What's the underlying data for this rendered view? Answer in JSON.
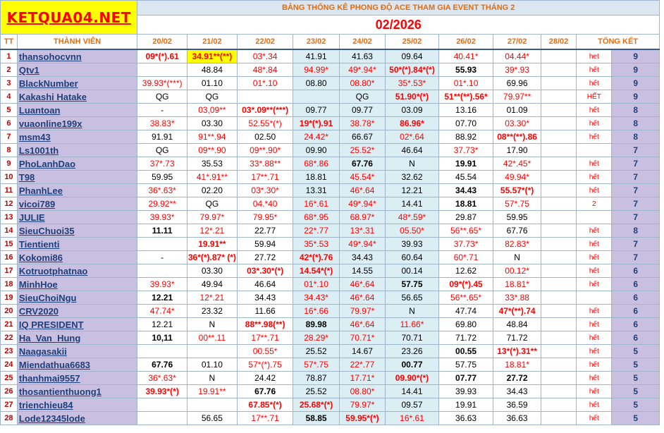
{
  "header": {
    "logo": "KETQUA04.NET",
    "title": "BẢNG THỐNG KÊ PHONG ĐỘ ACE THAM GIA EVENT THÁNG 2",
    "month": "02/2026",
    "col_tt": "TT",
    "col_member": "THÀNH VIÊN",
    "col_total": "TỔNG KẾT",
    "dates": [
      "20/02",
      "21/02",
      "22/02",
      "23/02",
      "24/02",
      "25/02",
      "26/02",
      "27/02",
      "28/02"
    ]
  },
  "rows": [
    {
      "tt": "1",
      "name": "thansohocvnn",
      "cells": [
        {
          "v": "09*(*).61",
          "s": "rb"
        },
        {
          "v": "34.91**(**)",
          "s": "rby"
        },
        {
          "v": "03*.34",
          "s": "r"
        },
        {
          "v": "41.91",
          "s": ""
        },
        {
          "v": "41.63",
          "s": ""
        },
        {
          "v": "09.64",
          "s": ""
        },
        {
          "v": "40.41*",
          "s": "r"
        },
        {
          "v": "04.44*",
          "s": "r"
        },
        {
          "v": "",
          "s": ""
        }
      ],
      "note": "het",
      "total": "9"
    },
    {
      "tt": "2",
      "name": "Qtv1",
      "cells": [
        {
          "v": "",
          "s": ""
        },
        {
          "v": "48.84",
          "s": ""
        },
        {
          "v": "48*.84",
          "s": "r"
        },
        {
          "v": "94.99*",
          "s": "r"
        },
        {
          "v": "49*.94*",
          "s": "r"
        },
        {
          "v": "50*(*).84*(*)",
          "s": "rb"
        },
        {
          "v": "55.93",
          "s": "b"
        },
        {
          "v": "39*.93",
          "s": "r"
        },
        {
          "v": "",
          "s": ""
        }
      ],
      "note": "hết",
      "total": "9"
    },
    {
      "tt": "3",
      "name": "BlackNumber",
      "cells": [
        {
          "v": "39.93*(***)",
          "s": "r"
        },
        {
          "v": "01.10",
          "s": ""
        },
        {
          "v": "01*.10",
          "s": "r"
        },
        {
          "v": "08.80",
          "s": ""
        },
        {
          "v": "08.80*",
          "s": "r"
        },
        {
          "v": "35*.53*",
          "s": "r"
        },
        {
          "v": "01*.10",
          "s": "r"
        },
        {
          "v": "69.96",
          "s": ""
        },
        {
          "v": "",
          "s": ""
        }
      ],
      "note": "hết",
      "total": "9"
    },
    {
      "tt": "4",
      "name": "Kakashi Hatake",
      "cells": [
        {
          "v": "QG",
          "s": ""
        },
        {
          "v": "QG",
          "s": ""
        },
        {
          "v": "",
          "s": ""
        },
        {
          "v": "",
          "s": ""
        },
        {
          "v": "QG",
          "s": ""
        },
        {
          "v": "51.90*(*)",
          "s": "rb"
        },
        {
          "v": "51**(**).56*",
          "s": "rb"
        },
        {
          "v": "79.97**",
          "s": "r"
        },
        {
          "v": "",
          "s": ""
        }
      ],
      "note": "HẾT",
      "total": "9"
    },
    {
      "tt": "5",
      "name": "Luantoan",
      "cells": [
        {
          "v": "-",
          "s": ""
        },
        {
          "v": "03,09**",
          "s": "r"
        },
        {
          "v": "03*.09**(***)",
          "s": "rb"
        },
        {
          "v": "09.77",
          "s": ""
        },
        {
          "v": "09.77",
          "s": ""
        },
        {
          "v": "03.09",
          "s": ""
        },
        {
          "v": "13.16",
          "s": ""
        },
        {
          "v": "01.09",
          "s": ""
        },
        {
          "v": "",
          "s": ""
        }
      ],
      "note": "hết",
      "total": "8"
    },
    {
      "tt": "6",
      "name": "vuaonline199x",
      "cells": [
        {
          "v": "38.83*",
          "s": "r"
        },
        {
          "v": "03.30",
          "s": ""
        },
        {
          "v": "52.55*(*)",
          "s": "r"
        },
        {
          "v": "19*(*).91",
          "s": "rb"
        },
        {
          "v": "38.78*",
          "s": "r"
        },
        {
          "v": "86.96*",
          "s": "rb"
        },
        {
          "v": "07.70",
          "s": ""
        },
        {
          "v": "03.30*",
          "s": "r"
        },
        {
          "v": "",
          "s": ""
        }
      ],
      "note": "hết",
      "total": "8"
    },
    {
      "tt": "7",
      "name": "msm43",
      "cells": [
        {
          "v": "91.91",
          "s": ""
        },
        {
          "v": "91**.94",
          "s": "r"
        },
        {
          "v": "02.50",
          "s": ""
        },
        {
          "v": "24.42*",
          "s": "r"
        },
        {
          "v": "66.67",
          "s": ""
        },
        {
          "v": "02*.64",
          "s": "r"
        },
        {
          "v": "88.92",
          "s": ""
        },
        {
          "v": "08**(**).86",
          "s": "rb"
        },
        {
          "v": "",
          "s": ""
        }
      ],
      "note": "hết",
      "total": "8"
    },
    {
      "tt": "8",
      "name": "Ls1001th",
      "cells": [
        {
          "v": "QG",
          "s": ""
        },
        {
          "v": "09**.90",
          "s": "r"
        },
        {
          "v": "09**.90*",
          "s": "r"
        },
        {
          "v": "09.90",
          "s": ""
        },
        {
          "v": "25.52*",
          "s": "r"
        },
        {
          "v": "46.64",
          "s": ""
        },
        {
          "v": "37.73*",
          "s": "r"
        },
        {
          "v": "17.90",
          "s": ""
        },
        {
          "v": "",
          "s": ""
        }
      ],
      "note": "",
      "total": "7"
    },
    {
      "tt": "9",
      "name": "PhoLanhDao",
      "cells": [
        {
          "v": "37*.73",
          "s": "r"
        },
        {
          "v": "35.53",
          "s": ""
        },
        {
          "v": "33*.88**",
          "s": "r"
        },
        {
          "v": "68*.86",
          "s": "r"
        },
        {
          "v": "67.76",
          "s": "b"
        },
        {
          "v": "N",
          "s": ""
        },
        {
          "v": "19.91",
          "s": "b"
        },
        {
          "v": "42*.45*",
          "s": "r"
        },
        {
          "v": "",
          "s": ""
        }
      ],
      "note": "hết",
      "total": "7"
    },
    {
      "tt": "10",
      "name": "T98",
      "cells": [
        {
          "v": "59.95",
          "s": ""
        },
        {
          "v": "41*.91**",
          "s": "r"
        },
        {
          "v": "17**.71",
          "s": "r"
        },
        {
          "v": "18.81",
          "s": ""
        },
        {
          "v": "45.54*",
          "s": "r"
        },
        {
          "v": "32.62",
          "s": ""
        },
        {
          "v": "45.54",
          "s": ""
        },
        {
          "v": "49.94*",
          "s": "r"
        },
        {
          "v": "",
          "s": ""
        }
      ],
      "note": "hết",
      "total": "7"
    },
    {
      "tt": "11",
      "name": "PhanhLee",
      "cells": [
        {
          "v": "36*.63*",
          "s": "r"
        },
        {
          "v": "02.20",
          "s": ""
        },
        {
          "v": "03*.30*",
          "s": "r"
        },
        {
          "v": "13.31",
          "s": ""
        },
        {
          "v": "46*.64",
          "s": "r"
        },
        {
          "v": "12.21",
          "s": ""
        },
        {
          "v": "34.43",
          "s": "b"
        },
        {
          "v": "55.57*(*)",
          "s": "rb"
        },
        {
          "v": "",
          "s": ""
        }
      ],
      "note": "hết",
      "total": "7"
    },
    {
      "tt": "12",
      "name": "vicoi789",
      "cells": [
        {
          "v": "29.92**",
          "s": "r"
        },
        {
          "v": "QG",
          "s": ""
        },
        {
          "v": "04.*40",
          "s": "r"
        },
        {
          "v": "16*.61",
          "s": "r"
        },
        {
          "v": "49*.94*",
          "s": "r"
        },
        {
          "v": "14.41",
          "s": ""
        },
        {
          "v": "18.81",
          "s": "b"
        },
        {
          "v": "57*.75",
          "s": "r"
        },
        {
          "v": "",
          "s": ""
        }
      ],
      "note": "2",
      "total": "7"
    },
    {
      "tt": "13",
      "name": "JULIE",
      "cells": [
        {
          "v": "39.93*",
          "s": "r"
        },
        {
          "v": "79.97*",
          "s": "r"
        },
        {
          "v": "79.95*",
          "s": "r"
        },
        {
          "v": "68*.95",
          "s": "r"
        },
        {
          "v": "68.97*",
          "s": "r"
        },
        {
          "v": "48*.59*",
          "s": "r"
        },
        {
          "v": "29.87",
          "s": ""
        },
        {
          "v": "59.95",
          "s": ""
        },
        {
          "v": "",
          "s": ""
        }
      ],
      "note": "",
      "total": "7"
    },
    {
      "tt": "14",
      "name": "SieuChuoi35",
      "cells": [
        {
          "v": "11.11",
          "s": "b"
        },
        {
          "v": "12*.21",
          "s": "r"
        },
        {
          "v": "22.77",
          "s": ""
        },
        {
          "v": "22*.77",
          "s": "r"
        },
        {
          "v": "13*.31",
          "s": "r"
        },
        {
          "v": "05.50*",
          "s": "r"
        },
        {
          "v": "56**.65*",
          "s": "r"
        },
        {
          "v": "67.76",
          "s": ""
        },
        {
          "v": "",
          "s": ""
        }
      ],
      "note": "hết",
      "total": "8"
    },
    {
      "tt": "15",
      "name": "Tientienti",
      "cells": [
        {
          "v": "",
          "s": ""
        },
        {
          "v": "19.91**",
          "s": "rb"
        },
        {
          "v": "59.94",
          "s": ""
        },
        {
          "v": "35*.53",
          "s": "r"
        },
        {
          "v": "49*.94*",
          "s": "r"
        },
        {
          "v": "39.93",
          "s": ""
        },
        {
          "v": "37.73*",
          "s": "r"
        },
        {
          "v": "82.83*",
          "s": "r"
        },
        {
          "v": "",
          "s": ""
        }
      ],
      "note": "hết",
      "total": "7"
    },
    {
      "tt": "16",
      "name": "Kokomi86",
      "cells": [
        {
          "v": "-",
          "s": ""
        },
        {
          "v": "36*(*).87* (*)",
          "s": "rb"
        },
        {
          "v": "27.72",
          "s": ""
        },
        {
          "v": "42*(*).76",
          "s": "rb"
        },
        {
          "v": "34.43",
          "s": ""
        },
        {
          "v": "60.64",
          "s": ""
        },
        {
          "v": "60*.71",
          "s": "r"
        },
        {
          "v": "N",
          "s": ""
        },
        {
          "v": "",
          "s": ""
        }
      ],
      "note": "hết",
      "total": "7"
    },
    {
      "tt": "17",
      "name": "Kotruotphatnao",
      "cells": [
        {
          "v": "",
          "s": ""
        },
        {
          "v": "03.30",
          "s": ""
        },
        {
          "v": "03*.30*(*)",
          "s": "rb"
        },
        {
          "v": "14.54*(*)",
          "s": "rb"
        },
        {
          "v": "14.55",
          "s": ""
        },
        {
          "v": "00.14",
          "s": ""
        },
        {
          "v": "12.62",
          "s": ""
        },
        {
          "v": "00.12*",
          "s": "r"
        },
        {
          "v": "",
          "s": ""
        }
      ],
      "note": "hết",
      "total": "6"
    },
    {
      "tt": "18",
      "name": "MinhHoe",
      "cells": [
        {
          "v": "39.93*",
          "s": "r"
        },
        {
          "v": "49.94",
          "s": ""
        },
        {
          "v": "46.64",
          "s": ""
        },
        {
          "v": "01*.10",
          "s": "r"
        },
        {
          "v": "46*.64",
          "s": "r"
        },
        {
          "v": "57.75",
          "s": "b"
        },
        {
          "v": "09*(*).45",
          "s": "rb"
        },
        {
          "v": "18.81*",
          "s": "r"
        },
        {
          "v": "",
          "s": ""
        }
      ],
      "note": "hết",
      "total": "6"
    },
    {
      "tt": "19",
      "name": "SieuChoiNgu",
      "cells": [
        {
          "v": "12.21",
          "s": "b"
        },
        {
          "v": "12*.21",
          "s": "r"
        },
        {
          "v": "34.43",
          "s": ""
        },
        {
          "v": "34.43*",
          "s": "r"
        },
        {
          "v": "46*.64",
          "s": "r"
        },
        {
          "v": "56.65",
          "s": ""
        },
        {
          "v": "56**.65*",
          "s": "r"
        },
        {
          "v": "33*.88",
          "s": "r"
        },
        {
          "v": "",
          "s": ""
        }
      ],
      "note": "",
      "total": "6"
    },
    {
      "tt": "20",
      "name": "CRV2020",
      "cells": [
        {
          "v": "47.74*",
          "s": "r"
        },
        {
          "v": "23.32",
          "s": ""
        },
        {
          "v": "11.66",
          "s": ""
        },
        {
          "v": "16*.66",
          "s": "r"
        },
        {
          "v": "79.97*",
          "s": "r"
        },
        {
          "v": "N",
          "s": ""
        },
        {
          "v": "47.74",
          "s": ""
        },
        {
          "v": "47*(**).74",
          "s": "rb"
        },
        {
          "v": "",
          "s": ""
        }
      ],
      "note": "hết",
      "total": "6"
    },
    {
      "tt": "21",
      "name": "IQ PRESIDENT",
      "cells": [
        {
          "v": "12.21",
          "s": ""
        },
        {
          "v": "N",
          "s": ""
        },
        {
          "v": "88**.98(**)",
          "s": "rb"
        },
        {
          "v": "89.98",
          "s": "b"
        },
        {
          "v": "46*.64",
          "s": "r"
        },
        {
          "v": "11.66*",
          "s": "r"
        },
        {
          "v": "69.80",
          "s": ""
        },
        {
          "v": "48.84",
          "s": ""
        },
        {
          "v": "",
          "s": ""
        }
      ],
      "note": "hết",
      "total": "6"
    },
    {
      "tt": "22",
      "name": "Ha_Van_Hung",
      "cells": [
        {
          "v": "10,11",
          "s": "b"
        },
        {
          "v": "00**.11",
          "s": "r"
        },
        {
          "v": "17**.71",
          "s": "r"
        },
        {
          "v": "28.29*",
          "s": "r"
        },
        {
          "v": "70.71*",
          "s": "r"
        },
        {
          "v": "70.71",
          "s": ""
        },
        {
          "v": "71.72",
          "s": ""
        },
        {
          "v": "71.72",
          "s": ""
        },
        {
          "v": "",
          "s": ""
        }
      ],
      "note": "hết",
      "total": "6"
    },
    {
      "tt": "23",
      "name": "Naagasakii",
      "cells": [
        {
          "v": "",
          "s": ""
        },
        {
          "v": "",
          "s": ""
        },
        {
          "v": "00.55*",
          "s": "r"
        },
        {
          "v": "25.52",
          "s": ""
        },
        {
          "v": "14.67",
          "s": ""
        },
        {
          "v": "23.26",
          "s": ""
        },
        {
          "v": "00.55",
          "s": "b"
        },
        {
          "v": "13*(*).31**",
          "s": "rb"
        },
        {
          "v": "",
          "s": ""
        }
      ],
      "note": "hết",
      "total": "5"
    },
    {
      "tt": "24",
      "name": "Miendathua6683",
      "cells": [
        {
          "v": "67.76",
          "s": "b"
        },
        {
          "v": "01.10",
          "s": ""
        },
        {
          "v": "57*(*).75",
          "s": "r"
        },
        {
          "v": "57*.75",
          "s": "r"
        },
        {
          "v": "22*.77",
          "s": "r"
        },
        {
          "v": "00.77",
          "s": "b"
        },
        {
          "v": "57.75",
          "s": ""
        },
        {
          "v": "18.81*",
          "s": "r"
        },
        {
          "v": "",
          "s": ""
        }
      ],
      "note": "hết",
      "total": "5"
    },
    {
      "tt": "25",
      "name": "thanhmai9557",
      "cells": [
        {
          "v": "36*.63*",
          "s": "r"
        },
        {
          "v": "N",
          "s": ""
        },
        {
          "v": "24.42",
          "s": ""
        },
        {
          "v": "78.87",
          "s": ""
        },
        {
          "v": "17.71*",
          "s": "r"
        },
        {
          "v": "09.90*(*)",
          "s": "rb"
        },
        {
          "v": "07.77",
          "s": "b"
        },
        {
          "v": "27.72",
          "s": "b"
        },
        {
          "v": "",
          "s": ""
        }
      ],
      "note": "hết",
      "total": "5"
    },
    {
      "tt": "26",
      "name": "thosantienthuong1",
      "cells": [
        {
          "v": "39.93*(*)",
          "s": "rb"
        },
        {
          "v": "19.91**",
          "s": "r"
        },
        {
          "v": "67.76",
          "s": "b"
        },
        {
          "v": "25.52",
          "s": ""
        },
        {
          "v": "08.80*",
          "s": "r"
        },
        {
          "v": "14.41",
          "s": ""
        },
        {
          "v": "39.93",
          "s": ""
        },
        {
          "v": "34.43",
          "s": ""
        },
        {
          "v": "",
          "s": ""
        }
      ],
      "note": "hết",
      "total": "5"
    },
    {
      "tt": "27",
      "name": "trienchieu84",
      "cells": [
        {
          "v": "",
          "s": ""
        },
        {
          "v": "",
          "s": ""
        },
        {
          "v": "67.85*(*)",
          "s": "rb"
        },
        {
          "v": "25.68*(*)",
          "s": "rb"
        },
        {
          "v": "79.97*",
          "s": "r"
        },
        {
          "v": "09.57",
          "s": ""
        },
        {
          "v": "19.91",
          "s": ""
        },
        {
          "v": "36.59",
          "s": ""
        },
        {
          "v": "",
          "s": ""
        }
      ],
      "note": "hết",
      "total": "5"
    },
    {
      "tt": "28",
      "name": "Lode12345lode",
      "cells": [
        {
          "v": "",
          "s": ""
        },
        {
          "v": "56.65",
          "s": ""
        },
        {
          "v": "17**.71",
          "s": "r"
        },
        {
          "v": "58.85",
          "s": "b"
        },
        {
          "v": "59.95*(*)",
          "s": "rb"
        },
        {
          "v": "16*.61",
          "s": "r"
        },
        {
          "v": "36.63",
          "s": ""
        },
        {
          "v": "36.63",
          "s": ""
        },
        {
          "v": "",
          "s": ""
        }
      ],
      "note": "hết",
      "total": "5"
    }
  ]
}
